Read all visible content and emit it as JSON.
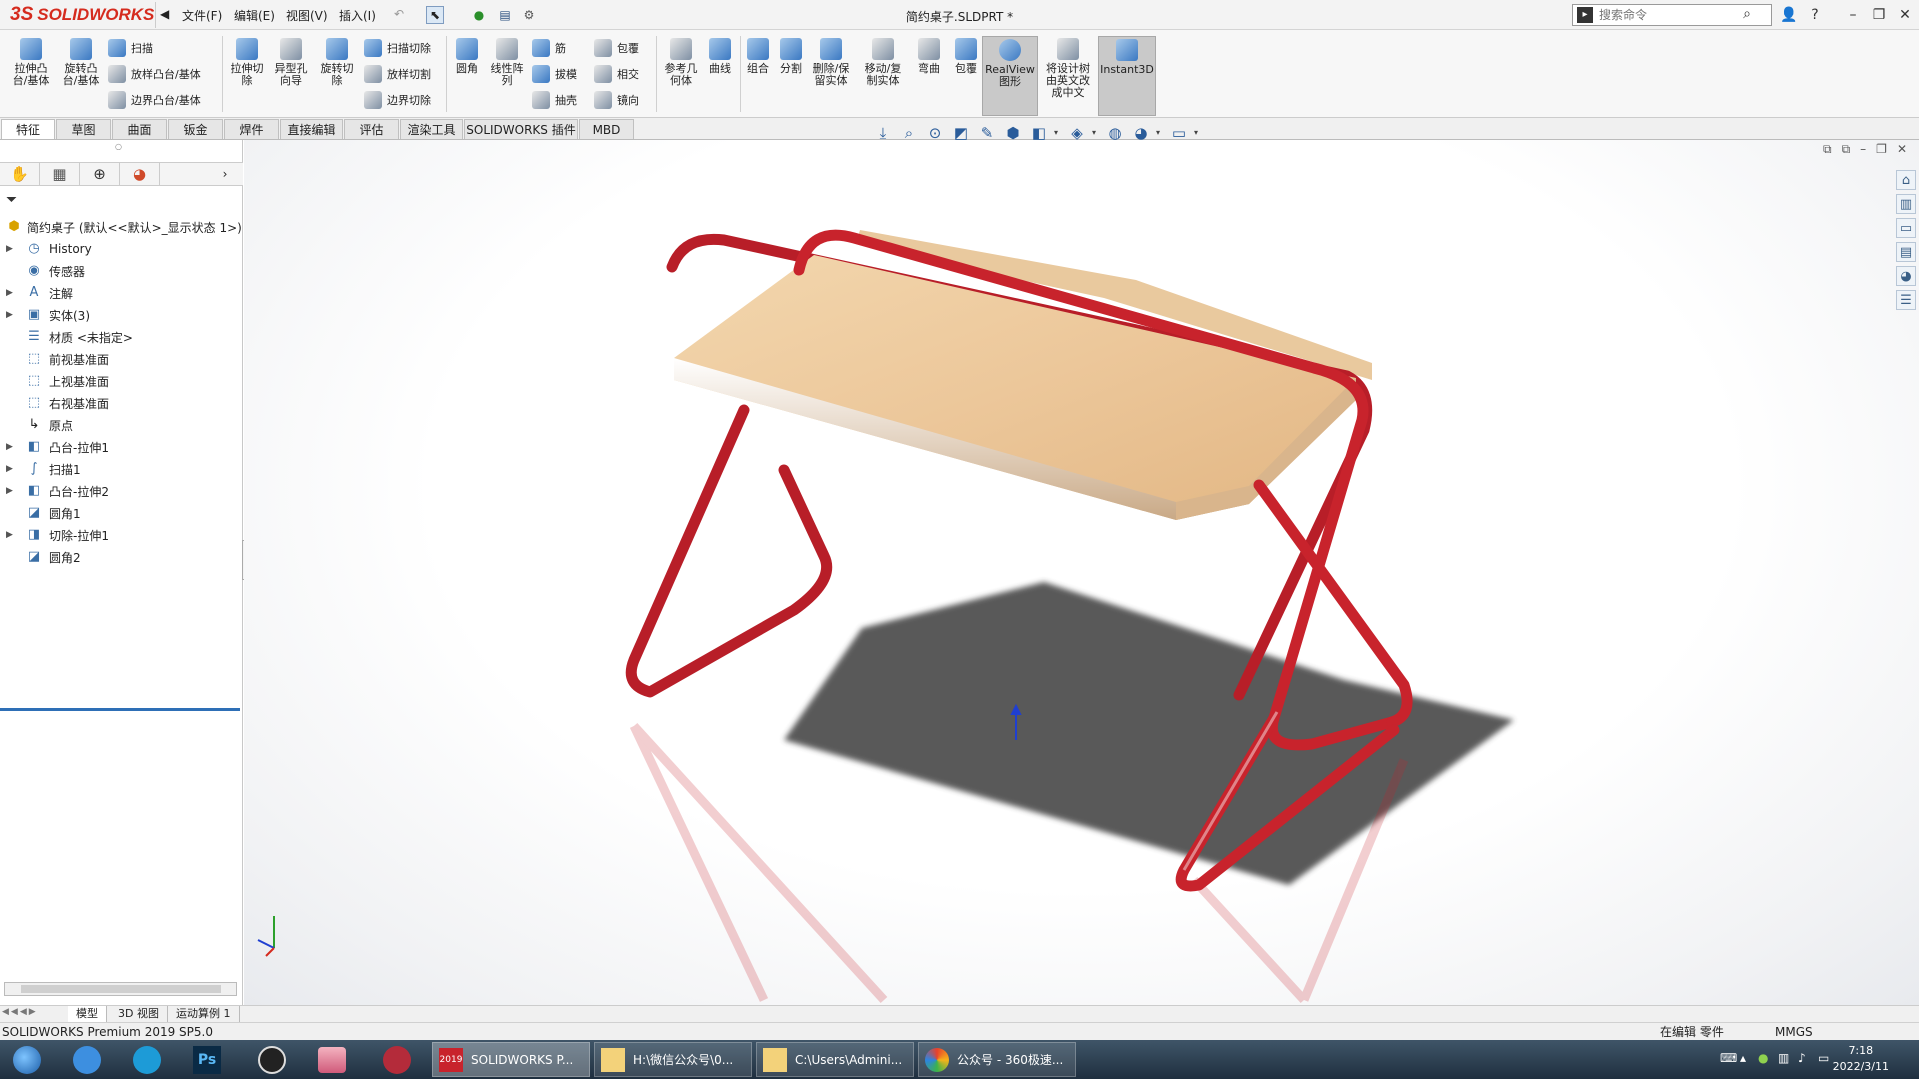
{
  "app": {
    "logo_ds": "3S",
    "logo_text": "SOLIDWORKS",
    "document_title": "简约桌子.SLDPRT *",
    "menus": [
      "文件(F)",
      "编辑(E)",
      "视图(V)",
      "插入(I)"
    ],
    "search_placeholder": "搜索命令"
  },
  "ribbon": {
    "extrude_boss": "拉伸凸\n台/基体",
    "revolve_boss": "旋转凸\n台/基体",
    "sweep": "扫描",
    "loft_boss": "放样凸台/基体",
    "boundary_boss": "边界凸台/基体",
    "extrude_cut": "拉伸切\n除",
    "hole_wizard": "异型孔\n向导",
    "revolve_cut": "旋转切\n除",
    "swept_cut": "扫描切除",
    "lofted_cut": "放样切割",
    "boundary_cut": "边界切除",
    "fillet": "圆角",
    "linear_pattern": "线性阵\n列",
    "rib": "筋",
    "draft": "拔模",
    "shell": "抽壳",
    "wrap": "包覆",
    "intersect": "相交",
    "mirror": "镜向",
    "ref_geometry": "参考几\n何体",
    "curves": "曲线",
    "combine": "组合",
    "split": "分割",
    "delete_keep": "删除/保\n留实体",
    "move_copy": "移动/复\n制实体",
    "flex": "弯曲",
    "wrap2": "包覆",
    "realview": "RealView\n图形",
    "design_translate": "将设计树\n由英文改\n成中文",
    "instant3d": "Instant3D"
  },
  "tabs": [
    "特征",
    "草图",
    "曲面",
    "钣金",
    "焊件",
    "直接编辑",
    "评估",
    "渲染工具",
    "SOLIDWORKS 插件",
    "MBD"
  ],
  "tree": {
    "root": "简约桌子  (默认<<默认>_显示状态 1>)",
    "items": [
      {
        "label": "History",
        "icon": "history-icon",
        "expandable": true
      },
      {
        "label": "传感器",
        "icon": "sensor-icon",
        "expandable": false
      },
      {
        "label": "注解",
        "icon": "annotation-icon",
        "expandable": true
      },
      {
        "label": "实体(3)",
        "icon": "solid-bodies-icon",
        "expandable": true
      },
      {
        "label": "材质 <未指定>",
        "icon": "material-icon",
        "expandable": false
      },
      {
        "label": "前视基准面",
        "icon": "plane-icon",
        "expandable": false
      },
      {
        "label": "上视基准面",
        "icon": "plane-icon",
        "expandable": false
      },
      {
        "label": "右视基准面",
        "icon": "plane-icon",
        "expandable": false
      },
      {
        "label": "原点",
        "icon": "origin-icon",
        "expandable": false
      },
      {
        "label": "凸台-拉伸1",
        "icon": "extrude-icon",
        "expandable": true
      },
      {
        "label": "扫描1",
        "icon": "sweep-icon",
        "expandable": true
      },
      {
        "label": "凸台-拉伸2",
        "icon": "extrude-icon",
        "expandable": true
      },
      {
        "label": "圆角1",
        "icon": "fillet-icon",
        "expandable": false
      },
      {
        "label": "切除-拉伸1",
        "icon": "cut-extrude-icon",
        "expandable": true
      },
      {
        "label": "圆角2",
        "icon": "fillet-icon",
        "expandable": false
      }
    ]
  },
  "model_tabs": [
    "模型",
    "3D 视图",
    "运动算例 1"
  ],
  "status": {
    "product": "SOLIDWORKS Premium 2019 SP5.0",
    "editing": "在编辑 零件",
    "units": "MMGS"
  },
  "taskbar": {
    "tasks": [
      "SOLIDWORKS P...",
      "H:\\微信公众号\\0...",
      "C:\\Users\\Admini...",
      "公众号 - 360极速..."
    ],
    "sw_badge": "2019",
    "time": "7:18",
    "date": "2022/3/11"
  },
  "colors": {
    "accent": "#d52b1e",
    "tube": "#c8232c",
    "tabletop": "#ecc79a"
  }
}
